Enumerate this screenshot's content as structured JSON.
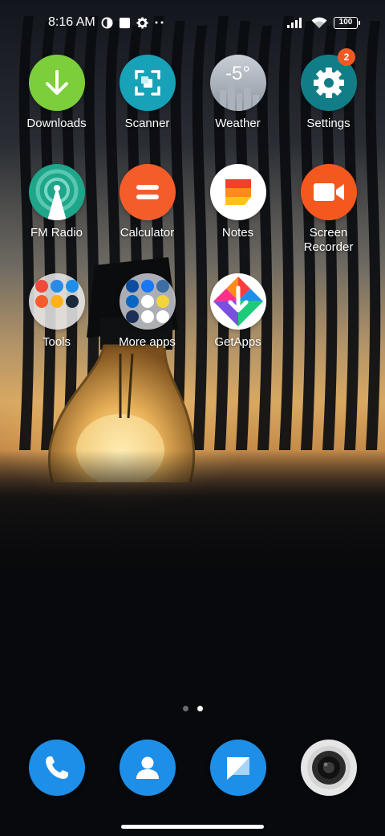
{
  "status_bar": {
    "time": "8:16 AM",
    "battery": "100",
    "icons": [
      "data-saver-icon",
      "notification-square-icon",
      "gear-icon",
      "more-dots-icon",
      "signal-icon",
      "wifi-icon",
      "battery-icon"
    ]
  },
  "apps": [
    {
      "id": "downloads",
      "label": "Downloads",
      "icon": "download-arrow-icon",
      "color": "#7ccf3b"
    },
    {
      "id": "scanner",
      "label": "Scanner",
      "icon": "scan-frame-icon",
      "color": "#17a2b8"
    },
    {
      "id": "weather",
      "label": "Weather",
      "icon": "weather-city-icon",
      "color": "#9aa3ad",
      "temp": "-5°"
    },
    {
      "id": "settings",
      "label": "Settings",
      "icon": "gear-icon",
      "color": "#117e87",
      "badge": "2"
    },
    {
      "id": "fm-radio",
      "label": "FM Radio",
      "icon": "radio-tower-icon",
      "color": "#1ea58a"
    },
    {
      "id": "calculator",
      "label": "Calculator",
      "icon": "equals-icon",
      "color": "#f45d2a"
    },
    {
      "id": "notes",
      "label": "Notes",
      "icon": "notes-icon",
      "color": "#ffffff"
    },
    {
      "id": "screen-recorder",
      "label": "Screen\nRecorder",
      "label_line1": "Screen",
      "label_line2": "Recorder",
      "icon": "video-camera-icon",
      "color": "#f4581f"
    },
    {
      "id": "tools",
      "label": "Tools",
      "icon": "folder-icon",
      "color": "#eeeeee"
    },
    {
      "id": "more-apps",
      "label": "More apps",
      "icon": "folder-icon",
      "color": "#eeeeee"
    },
    {
      "id": "getapps",
      "label": "GetApps",
      "icon": "getapps-icon",
      "color": "#ffffff"
    }
  ],
  "pager": {
    "pages": 2,
    "active": 2
  },
  "dock": [
    {
      "id": "phone",
      "icon": "phone-icon",
      "color": "#1e8fe8"
    },
    {
      "id": "contacts",
      "icon": "contact-person-icon",
      "color": "#1e8fe8"
    },
    {
      "id": "messages",
      "icon": "message-bubble-icon",
      "color": "#1e8fe8"
    },
    {
      "id": "camera",
      "icon": "camera-lens-icon",
      "color": "#e6e6e6"
    }
  ]
}
